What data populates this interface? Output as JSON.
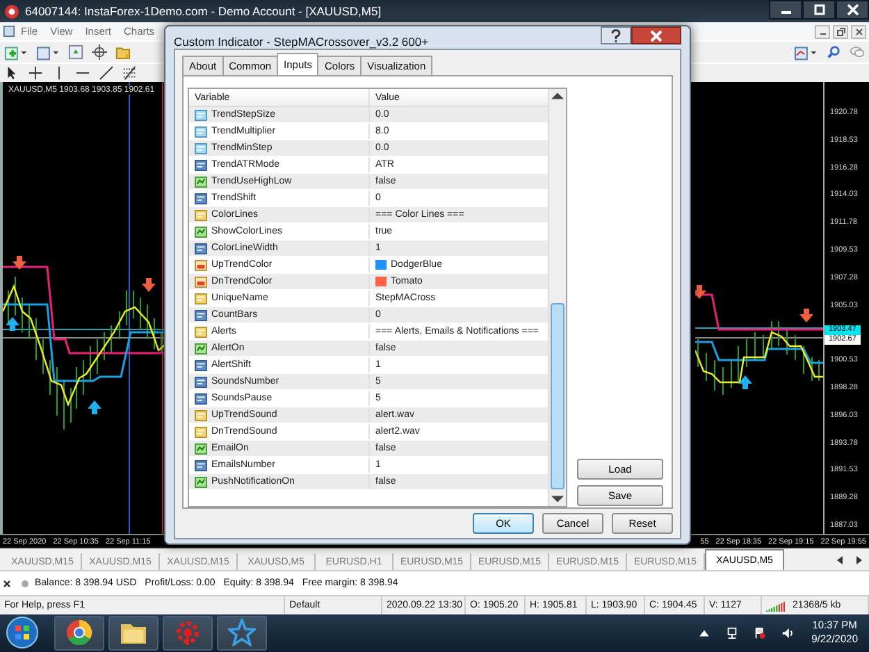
{
  "window": {
    "title": "64007144: InstaForex-1Demo.com - Demo Account - [XAUUSD,M5]"
  },
  "menu": [
    {
      "label": "File"
    },
    {
      "label": "View"
    },
    {
      "label": "Insert"
    },
    {
      "label": "Charts"
    }
  ],
  "left_chart": {
    "header": "XAUUSD,M5  1903.68 1903.85 1902.61",
    "time_labels": [
      "22 Sep 2020",
      "22 Sep 10:35",
      "22 Sep 11:15"
    ]
  },
  "right_chart": {
    "time_labels": [
      "55",
      "22 Sep 18:35",
      "22 Sep 19:15",
      "22 Sep 19:55"
    ],
    "price_labels": [
      "1920.78",
      "1918.53",
      "1916.28",
      "1914.03",
      "1911.78",
      "1909.53",
      "1907.28",
      "1905.03",
      "1900.53",
      "1898.28",
      "1896.03",
      "1893.78",
      "1891.53",
      "1889.28",
      "1887.03"
    ],
    "price_tags": [
      {
        "text": "1903.47",
        "color": "#00e5f0"
      },
      {
        "text": "1902.67",
        "color": "#ffffff"
      }
    ]
  },
  "dialog": {
    "title": "Custom Indicator - StepMACrossover_v3.2 600+",
    "tabs": [
      {
        "label": "About",
        "selected": false
      },
      {
        "label": "Common",
        "selected": false
      },
      {
        "label": "Inputs",
        "selected": true
      },
      {
        "label": "Colors",
        "selected": false
      },
      {
        "label": "Visualization",
        "selected": false
      }
    ],
    "columns": [
      "Variable",
      "Value"
    ],
    "rows": [
      {
        "kind": "double",
        "name": "TrendStepSize",
        "value": "0.0"
      },
      {
        "kind": "double",
        "name": "TrendMultiplier",
        "value": "8.0"
      },
      {
        "kind": "double",
        "name": "TrendMinStep",
        "value": "0.0"
      },
      {
        "kind": "int",
        "name": "TrendATRMode",
        "value": "ATR"
      },
      {
        "kind": "bool",
        "name": "TrendUseHighLow",
        "value": "false"
      },
      {
        "kind": "int",
        "name": "TrendShift",
        "value": "0"
      },
      {
        "kind": "string",
        "name": "ColorLines",
        "value": "=== Color Lines ==="
      },
      {
        "kind": "bool",
        "name": "ShowColorLines",
        "value": "true"
      },
      {
        "kind": "int",
        "name": "ColorLineWidth",
        "value": "1"
      },
      {
        "kind": "color",
        "name": "UpTrendColor",
        "value": "DodgerBlue",
        "color": "#1e90ff"
      },
      {
        "kind": "color",
        "name": "DnTrendColor",
        "value": "Tomato",
        "color": "#ff6347"
      },
      {
        "kind": "string",
        "name": "UniqueName",
        "value": "StepMACross"
      },
      {
        "kind": "int",
        "name": "CountBars",
        "value": "0"
      },
      {
        "kind": "string",
        "name": "Alerts",
        "value": "=== Alerts, Emails & Notifications ==="
      },
      {
        "kind": "bool",
        "name": "AlertOn",
        "value": "false"
      },
      {
        "kind": "int",
        "name": "AlertShift",
        "value": "1"
      },
      {
        "kind": "int",
        "name": "SoundsNumber",
        "value": "5"
      },
      {
        "kind": "int",
        "name": "SoundsPause",
        "value": "5"
      },
      {
        "kind": "string",
        "name": "UpTrendSound",
        "value": "alert.wav"
      },
      {
        "kind": "string",
        "name": "DnTrendSound",
        "value": "alert2.wav"
      },
      {
        "kind": "bool",
        "name": "EmailOn",
        "value": "false"
      },
      {
        "kind": "int",
        "name": "EmailsNumber",
        "value": "1"
      },
      {
        "kind": "bool",
        "name": "PushNotificationOn",
        "value": "false"
      }
    ],
    "side_buttons": [
      "Load",
      "Save"
    ],
    "buttons": [
      {
        "label": "OK",
        "default": true
      },
      {
        "label": "Cancel",
        "default": false
      },
      {
        "label": "Reset",
        "default": false
      }
    ]
  },
  "chart_tabs": [
    {
      "label": "XAUUSD,M15",
      "selected": false
    },
    {
      "label": "XAUUSD,M15",
      "selected": false
    },
    {
      "label": "XAUUSD,M15",
      "selected": false
    },
    {
      "label": "XAUUSD,M5",
      "selected": false
    },
    {
      "label": "EURUSD,H1",
      "selected": false
    },
    {
      "label": "EURUSD,M15",
      "selected": false
    },
    {
      "label": "EURUSD,M15",
      "selected": false
    },
    {
      "label": "EURUSD,M15",
      "selected": false
    },
    {
      "label": "EURUSD,M15",
      "selected": false
    },
    {
      "label": "XAUUSD,M5",
      "selected": true
    }
  ],
  "terminal": [
    "Balance: 8 398.94 USD",
    "Profit/Loss: 0.00",
    "Equity: 8 398.94",
    "Free margin: 8 398.94"
  ],
  "status_bar": [
    "For Help, press F1",
    "Default",
    "2020.09.22 13:30",
    "O: 1905.20",
    "H: 1905.81",
    "L: 1903.90",
    "C: 1904.45",
    "V: 1127",
    "21368/5 kb"
  ],
  "taskbar": {
    "apps": [
      {
        "kind": "chrome"
      },
      {
        "kind": "folder"
      },
      {
        "kind": "gear"
      },
      {
        "kind": "star"
      }
    ],
    "time": "10:37 PM",
    "date": "9/22/2020"
  }
}
